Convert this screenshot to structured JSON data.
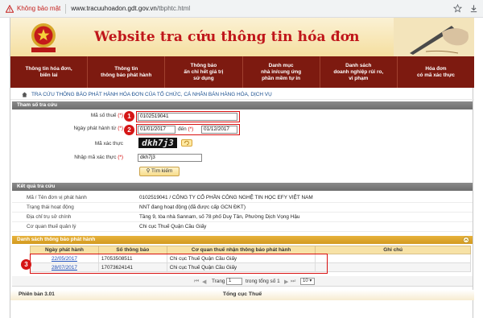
{
  "browser": {
    "security_label": "Không bảo mật",
    "url_host": "www.tracuuhoadon.gdt.gov.vn",
    "url_path": "/tbphtc.html"
  },
  "header": {
    "title": "Website tra cứu thông tin hóa đơn",
    "emblem_text": "THUẾ NHÀ NƯỚC"
  },
  "menu": [
    {
      "label": "Thông tin hóa đơn,\nbiên lai"
    },
    {
      "label": "Thông tin\nthông báo phát hành"
    },
    {
      "label": "Thông báo\nấn chỉ hết giá trị\nsử dụng"
    },
    {
      "label": "Danh mục\nnhà in/cung ứng\nphần mềm tự in"
    },
    {
      "label": "Danh sách\ndoanh nghiệp rủi ro,\nvi phạm"
    },
    {
      "label": "Hóa đơn\ncó mã xác thực"
    }
  ],
  "breadcrumb": "TRA CỨU THÔNG BÁO PHÁT HÀNH HÓA ĐƠN CỦA TỔ CHỨC, CÁ NHÂN BÁN HÀNG HÓA, DỊCH VỤ",
  "params": {
    "heading": "Tham số tra cứu",
    "tax_id_label": "Mã số thuế",
    "tax_id_value": "0102519041",
    "date_label": "Ngày phát hành từ",
    "date_from": "01/01/2017",
    "to_label": "đến",
    "date_to": "01/12/2017",
    "captcha_label": "Mã xác thực",
    "captcha_text": "dkh7j3",
    "captcha_input_label": "Nhập mã xác thực",
    "captcha_input": "dkh7j3",
    "required_mark": "(*)",
    "search_button": "Tìm kiếm"
  },
  "badges": [
    "1",
    "2",
    "3"
  ],
  "result": {
    "heading": "Kết quả tra cứu",
    "rows": [
      {
        "key": "Mã / Tên đơn vị phát hành",
        "value": "0102519041 / CÔNG TY CỔ PHẦN CÔNG NGHỆ TIN HỌC EFY VIỆT NAM"
      },
      {
        "key": "Trạng thái hoạt động",
        "value": "NNT đang hoạt động (đã được cấp GCN ĐKT)"
      },
      {
        "key": "Địa chỉ trụ sở chính",
        "value": "Tầng 9, tòa nhà Sannam, số 78 phố Duy Tân, Phường Dịch Vọng Hậu"
      },
      {
        "key": "Cơ quan thuế quản lý",
        "value": "Chi cục Thuế Quận Cầu Giấy"
      }
    ]
  },
  "notices": {
    "heading": "Danh sách thông báo phát hành",
    "columns": [
      "Ngày phát hành",
      "Số thông báo",
      "Cơ quan thuế nhận thông báo phát hành",
      "Ghi chú"
    ],
    "rows": [
      {
        "date": "22/05/2017",
        "number": "17053508511",
        "agency": "Chi cục Thuế Quận Cầu Giấy",
        "note": ""
      },
      {
        "date": "28/07/2017",
        "number": "17073624141",
        "agency": "Chi cục Thuế Quận Cầu Giấy",
        "note": ""
      }
    ]
  },
  "pager": {
    "page_label": "Trang",
    "page_value": "1",
    "total_label": "trong tổng số 1",
    "page_size": "10"
  },
  "footer": {
    "version": "Phiên bản 3.01",
    "org": "Tổng cục Thuế"
  }
}
